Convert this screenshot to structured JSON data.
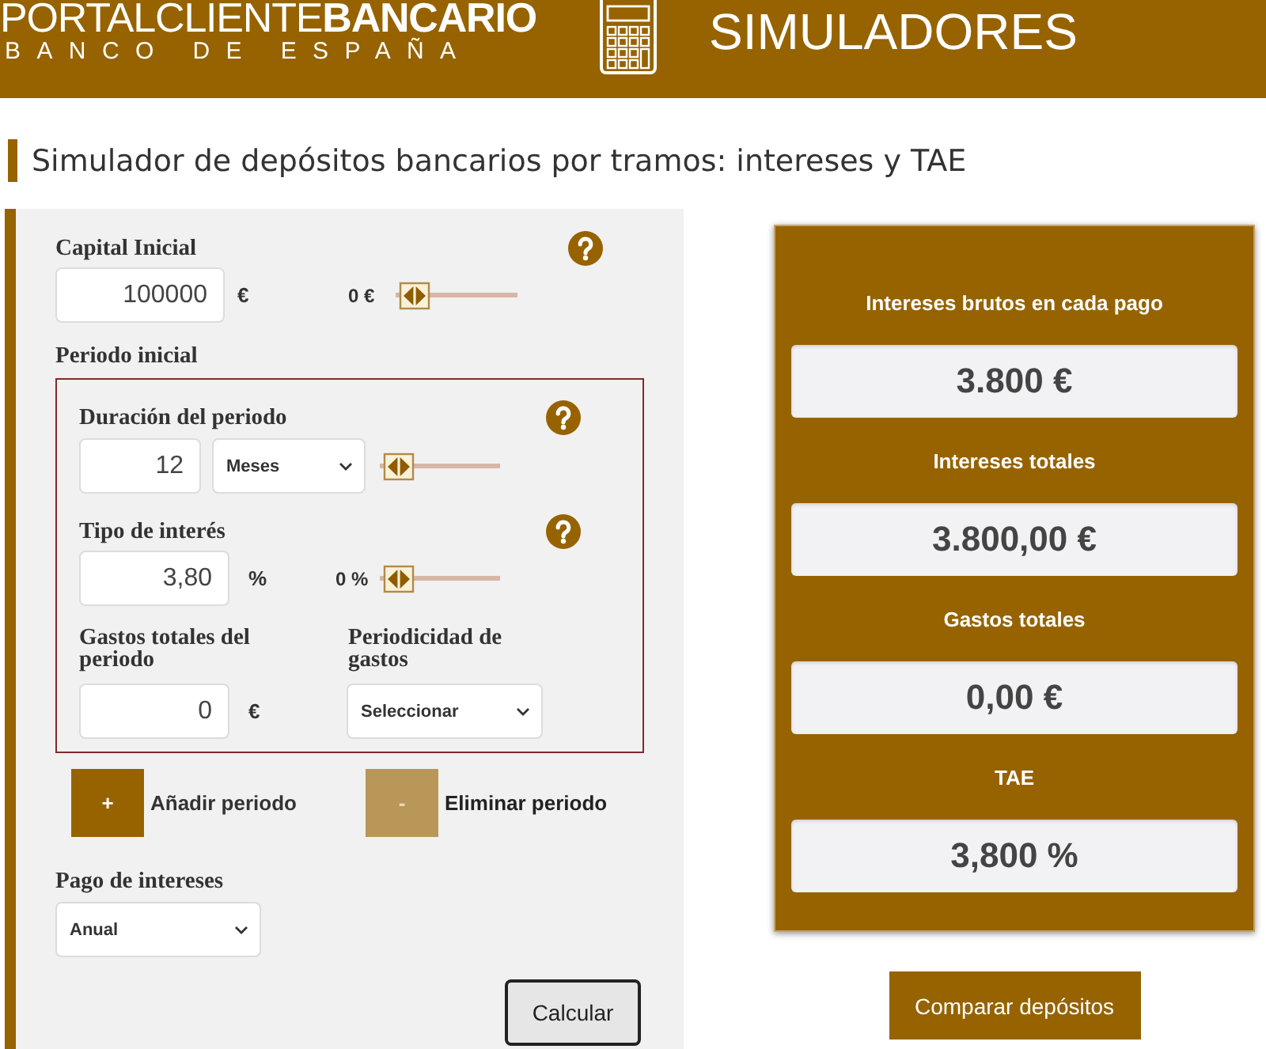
{
  "header": {
    "brand": "PORTALCLIENTE**BANCARIO**",
    "subtitle": "BANCO DE ESPAÑA",
    "section": "SIMULADORES"
  },
  "page_title": "Simulador de depósitos bancarios por tramos: intereses y TAE",
  "form": {
    "capital": {
      "label": "Capital Inicial",
      "value": "100000",
      "unit": "€",
      "slider_reading": "0 €",
      "level": 0
    },
    "period_heading": "Periodo inicial",
    "period": {
      "duration": {
        "label": "Duración del periodo",
        "value": "12",
        "unit_select": "Meses",
        "level": 0
      },
      "rate": {
        "label": "Tipo de interés",
        "value": "3,80",
        "unit": "%",
        "slider_reading": "0 %",
        "level": 0
      },
      "expenses": {
        "label": "Gastos totales del periodo",
        "value": "0",
        "unit": "€"
      },
      "expense_frequency": {
        "label": "Periodicidad de gastos",
        "value": "Seleccionar"
      }
    },
    "period_buttons": [
      {
        "symbol": "+",
        "label": "Añadir periodo",
        "disabled": false
      },
      {
        "symbol": "-",
        "label": "Eliminar periodo",
        "disabled": true
      }
    ],
    "interest_payment": {
      "label": "Pago de intereses",
      "value": "Anual"
    },
    "calculate_button": "Calcular"
  },
  "results": [
    {
      "label": "Intereses brutos en cada pago",
      "value": "3.800 €"
    },
    {
      "label": "Intereses totales",
      "value": "3.800,00 €"
    },
    {
      "label": "Gastos totales",
      "value": "0,00 €"
    },
    {
      "label": "TAE",
      "value": "3,800 %"
    }
  ],
  "compare_button": "Comparar depósitos"
}
